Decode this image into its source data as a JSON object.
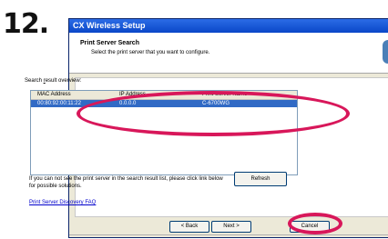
{
  "step_number": "12.",
  "window": {
    "title": "CX Wireless Setup",
    "header_title": "Print Server Search",
    "header_subtitle": "Select the print server that you want to configure."
  },
  "list": {
    "label_prefix": "Search ",
    "label_underlined": "r",
    "label_suffix": "esult overview:",
    "columns": [
      "MAC Address",
      "IP Address",
      "Print Server Name"
    ],
    "rows": [
      [
        "00:80:92:00:11:22",
        "0.0.0.0",
        "C-6700WG"
      ]
    ]
  },
  "hint_text": "If you can not see the print server in the search result list, please click link below for possible solutions.",
  "buttons": {
    "refresh": "Refresh",
    "back": "< Back",
    "next": "Next >",
    "cancel": "Cancel"
  },
  "faq_link": "Print Server Discovery FAQ",
  "colors": {
    "highlight_oval": "#d8175a",
    "selection": "#316ac5",
    "titlebar": "#0a47c8"
  }
}
